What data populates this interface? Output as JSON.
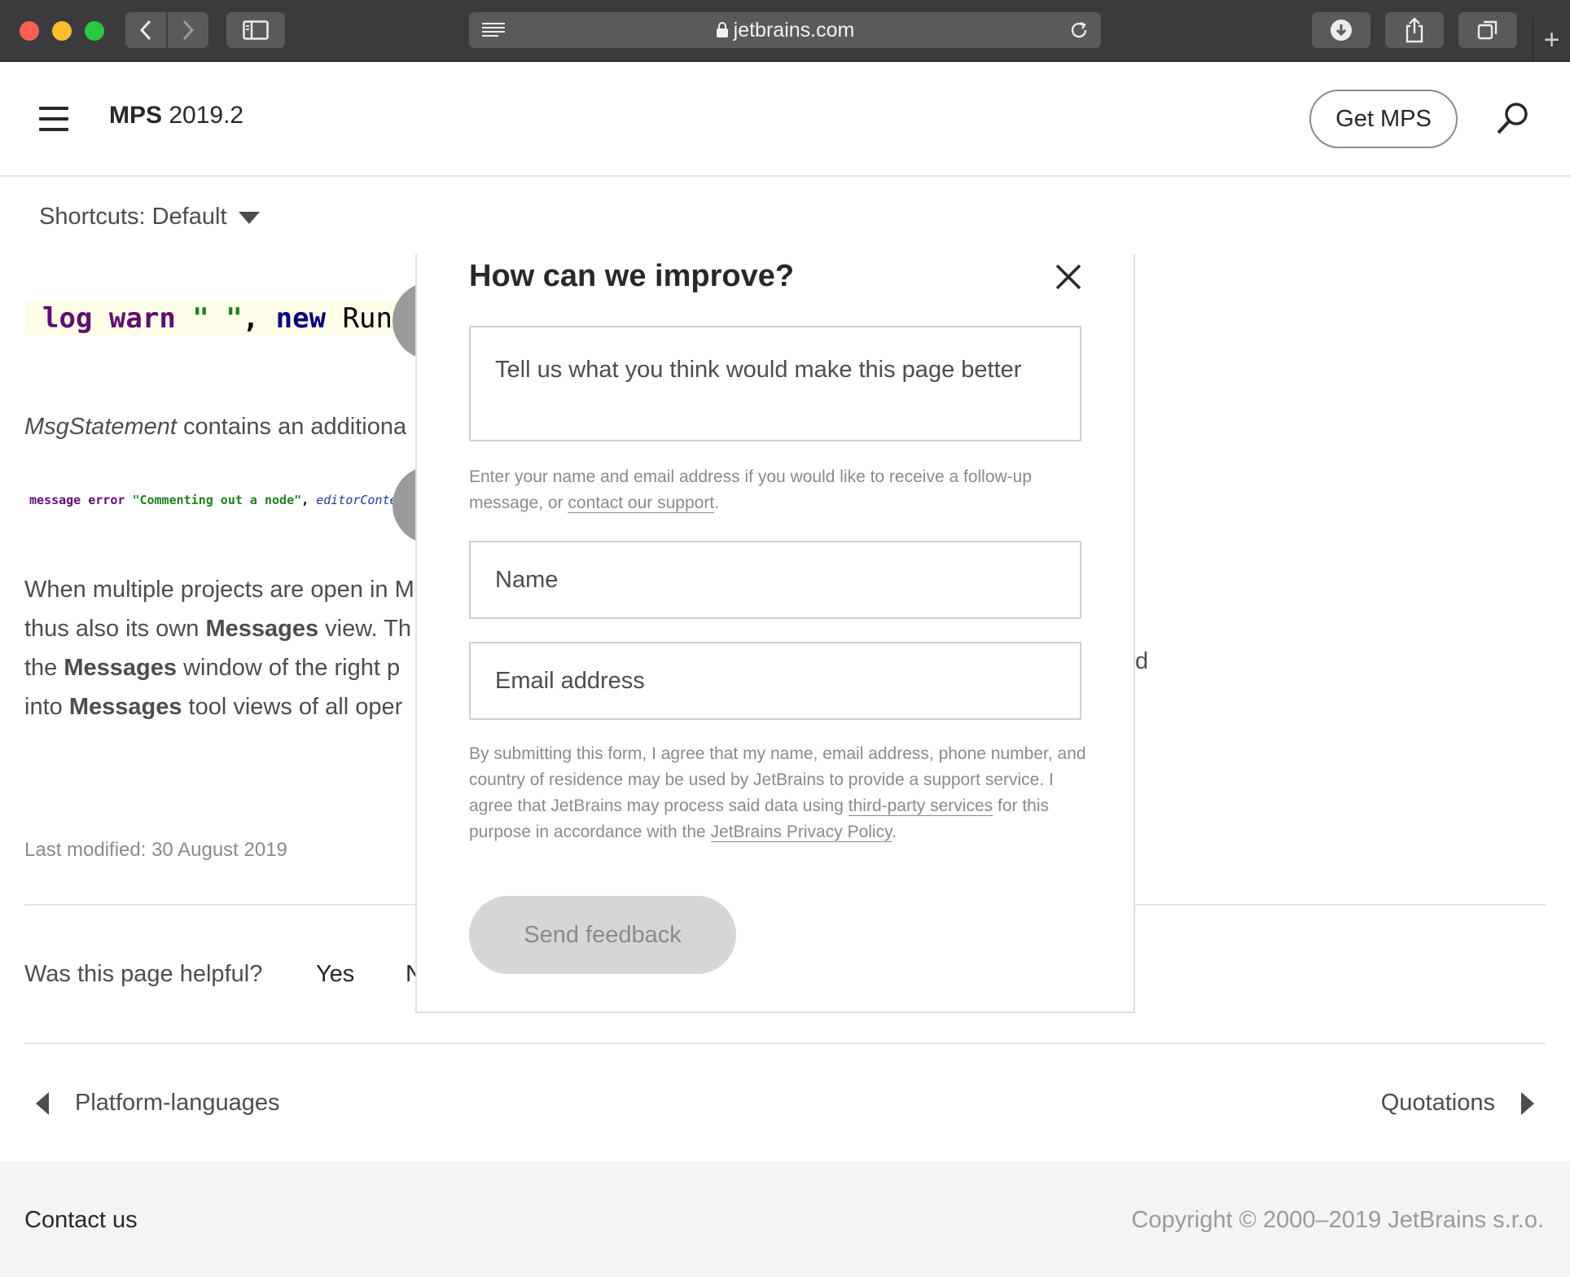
{
  "browser": {
    "url": "jetbrains.com",
    "new_tab_symbol": "+"
  },
  "header": {
    "product_name": "MPS",
    "version": "2019.2",
    "get_button": "Get MPS"
  },
  "content": {
    "shortcuts_label": "Shortcuts: Default",
    "code_line_1": {
      "log": "log",
      "warn": "warn",
      "quotes": "\" \"",
      "comma": ",",
      "new": "new",
      "run": "Run"
    },
    "para1_italic": "MsgStatement",
    "para1_rest": " contains an additiona",
    "code_line_2": {
      "message": "message",
      "error": "error",
      "string": "\"Commenting out a node\"",
      "comma": ",",
      "editor": "editorConte"
    },
    "body": {
      "l1": "When multiple projects are open in M",
      "l2a": "thus also its own ",
      "l2b": "Messages",
      "l2c": " view. Th",
      "l3a": "the ",
      "l3b": "Messages",
      "l3c": " window of the right p",
      "l4a": "into ",
      "l4b": "Messages",
      "l4c": " tool views of all oper"
    },
    "stray_char": "d",
    "last_modified": "Last modified: 30 August 2019",
    "helpful_question": "Was this page helpful?",
    "yes": "Yes",
    "no": "N",
    "prev": "Platform-languages",
    "next": "Quotations"
  },
  "footer": {
    "contact": "Contact us",
    "copyright": "Copyright © 2000–2019 JetBrains s.r.o."
  },
  "modal": {
    "title": "How can we improve?",
    "textarea_placeholder": "Tell us what you think would make this page better",
    "hint_before": "Enter your name and email address if you would like to receive a follow-up message, or ",
    "hint_link": "contact our support",
    "hint_after": ".",
    "name_placeholder": "Name",
    "email_placeholder": "Email address",
    "legal_1": "By submitting this form, I agree that my name, email address, phone number, and country of residence may be used by JetBrains to provide a support service. I agree that JetBrains may process said data using ",
    "legal_link_1": "third-party services",
    "legal_2": " for this purpose in accordance with the ",
    "legal_link_2": "JetBrains Privacy Policy",
    "legal_3": ".",
    "send_button": "Send feedback"
  }
}
